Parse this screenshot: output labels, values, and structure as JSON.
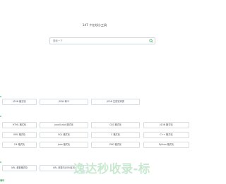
{
  "header": {
    "title": "147 个在线小工具"
  },
  "search": {
    "placeholder": "搜索一下"
  },
  "groups": [
    {
      "tools": [
        "JSON 格式化",
        "JSON 转义",
        "JSON 生成实体类"
      ]
    },
    {
      "tools": [
        "HTML 格式化",
        "JavaScript 格式化",
        "CSS 格式化",
        "JSON 格式化",
        "XML 格式化",
        "SQL 格式化",
        "C 格式化",
        "C++ 格式化",
        "C# 格式化",
        "Java 格式化",
        "PHP 格式化",
        "Python 格式化"
      ]
    },
    {
      "tools": [
        "URL 参数格式化",
        "URL 参数与JSON互转"
      ]
    }
  ],
  "banner": {
    "text": "逸达秒收录-标"
  },
  "footer": {
    "link": "编码"
  },
  "colors": {
    "accent": "#2a8a4a",
    "border": "#d6dde2"
  }
}
